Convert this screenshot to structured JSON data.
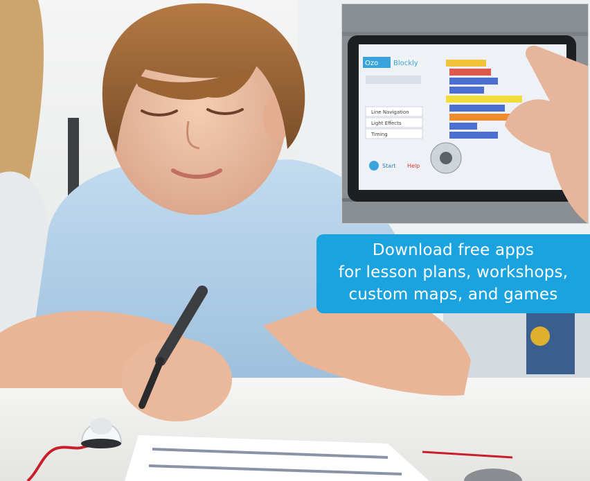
{
  "callout": {
    "line1": "Download free apps",
    "line2": "for lesson plans, workshops,",
    "line3": "custom maps, and games"
  },
  "tablet_app": {
    "logo_left": "Ozo",
    "logo_right": "Blockly",
    "menu_items": [
      "Line Navigation",
      "Light Effects",
      "Timing"
    ],
    "start_label": "Start",
    "help_label": "Help"
  },
  "colors": {
    "callout_bg": "#1aa3df",
    "shirt": "#b7d3ea",
    "floor_red_line": "#c8202a"
  }
}
